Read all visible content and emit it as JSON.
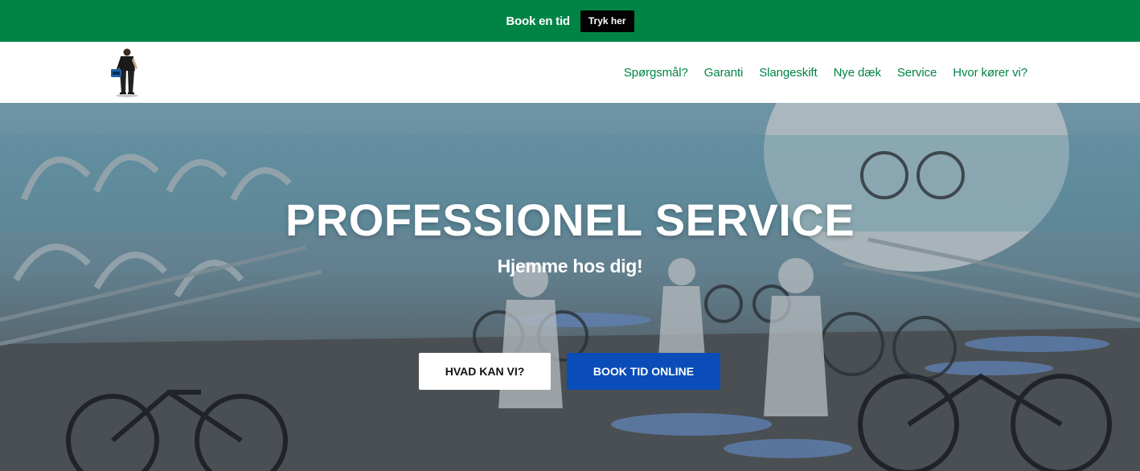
{
  "topbar": {
    "text": "Book en tid",
    "button_label": "Tryk her",
    "background": "#008446"
  },
  "header": {
    "logo_icon": "mechanic-person-logo",
    "nav": [
      {
        "label": "Spørgsmål?"
      },
      {
        "label": "Garanti"
      },
      {
        "label": "Slangeskift"
      },
      {
        "label": "Nye dæk"
      },
      {
        "label": "Service"
      },
      {
        "label": "Hvor kører vi?"
      }
    ],
    "nav_color": "#008446"
  },
  "hero": {
    "title": "PROFESSIONEL SERVICE",
    "subtitle": "Hjemme hos dig!",
    "buttons": {
      "primary": "HVAD KAN VI?",
      "secondary": "BOOK TID ONLINE"
    },
    "secondary_color": "#0a4db8"
  }
}
